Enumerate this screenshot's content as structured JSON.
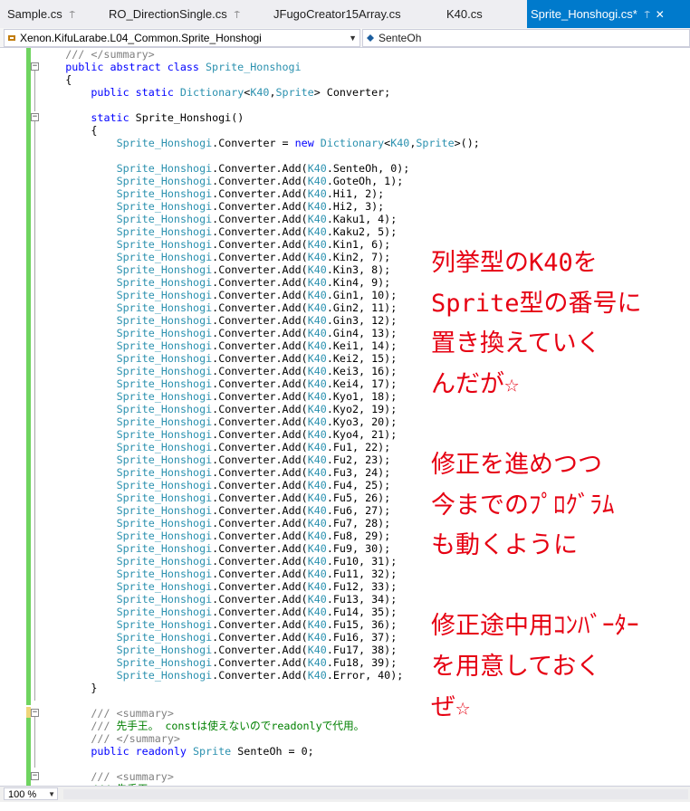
{
  "tabs": [
    {
      "label": "Sample.cs",
      "pin": "⍑"
    },
    {
      "label": "RO_DirectionSingle.cs",
      "pin": "⍑"
    },
    {
      "label": "JFugoCreator15Array.cs",
      "pin": ""
    },
    {
      "label": "K40.cs",
      "pin": ""
    },
    {
      "label": "Sprite_Honshogi.cs*",
      "pin": "⍑",
      "close": "✕",
      "active": true
    }
  ],
  "nav": {
    "left": "Xenon.KifuLarabe.L04_Common.Sprite_Honshogi",
    "right": "SenteOh"
  },
  "colors": {
    "keyword": "#0000ff",
    "type": "#2b91af",
    "comment": "#008000",
    "overlay": "#e60012",
    "changebar": "#6fd460",
    "changebar_pending": "#efd57a",
    "accent": "#007acc"
  },
  "code": {
    "summary_close": "/// </summary>",
    "class_decl": [
      "public abstract class ",
      "Sprite_Honshogi"
    ],
    "open_brace": "{",
    "close_brace": "}",
    "field_decl": [
      "public static ",
      "Dictionary",
      "<",
      "K40",
      ",",
      "Sprite",
      "> Converter;"
    ],
    "ctor_decl": [
      "static ",
      "Sprite_Honshogi()"
    ],
    "converter_init": [
      "Sprite_Honshogi",
      ".Converter = ",
      "new ",
      "Dictionary",
      "<",
      "K40",
      ",",
      "Sprite",
      ">();"
    ],
    "add_prefix": "Sprite_Honshogi",
    "add_mid": ".Converter.Add(",
    "add_enum": "K40",
    "add_entries": [
      ".SenteOh, 0);",
      ".GoteOh, 1);",
      ".Hi1, 2);",
      ".Hi2, 3);",
      ".Kaku1, 4);",
      ".Kaku2, 5);",
      ".Kin1, 6);",
      ".Kin2, 7);",
      ".Kin3, 8);",
      ".Kin4, 9);",
      ".Gin1, 10);",
      ".Gin2, 11);",
      ".Gin3, 12);",
      ".Gin4, 13);",
      ".Kei1, 14);",
      ".Kei2, 15);",
      ".Kei3, 16);",
      ".Kei4, 17);",
      ".Kyo1, 18);",
      ".Kyo2, 19);",
      ".Kyo3, 20);",
      ".Kyo4, 21);",
      ".Fu1, 22);",
      ".Fu2, 23);",
      ".Fu3, 24);",
      ".Fu4, 25);",
      ".Fu5, 26);",
      ".Fu6, 27);",
      ".Fu7, 28);",
      ".Fu8, 29);",
      ".Fu9, 30);",
      ".Fu10, 31);",
      ".Fu11, 32);",
      ".Fu12, 33);",
      ".Fu13, 34);",
      ".Fu14, 35);",
      ".Fu15, 36);",
      ".Fu16, 37);",
      ".Fu17, 38);",
      ".Fu18, 39);",
      ".Error, 40);"
    ],
    "summary_open": "/// <summary>",
    "sente_comment": "/// 先手王。 constは使えないのでreadonlyで代用。",
    "sente_decl": [
      "public readonly ",
      "Sprite",
      " SenteOh = 0;"
    ],
    "last_partial": "/// 先手王。"
  },
  "overlay_lines": [
    "列挙型のK40を",
    "Sprite型の番号に",
    "置き換えていく",
    "んだが☆",
    "",
    "修正を進めつつ",
    "今までのﾌﾟﾛｸﾞﾗﾑ",
    "も動くように",
    "",
    "修正途中用ｺﾝﾊﾞｰﾀｰ",
    "を用意しておく",
    "ぜ☆"
  ],
  "status": {
    "zoom": "100 %"
  },
  "icons": {
    "nav_left": "class-icon",
    "nav_right": "field-icon",
    "dropdown": "chevron-down-icon",
    "pin": "pin-icon",
    "close": "close-icon",
    "fold": "collapse-icon"
  }
}
